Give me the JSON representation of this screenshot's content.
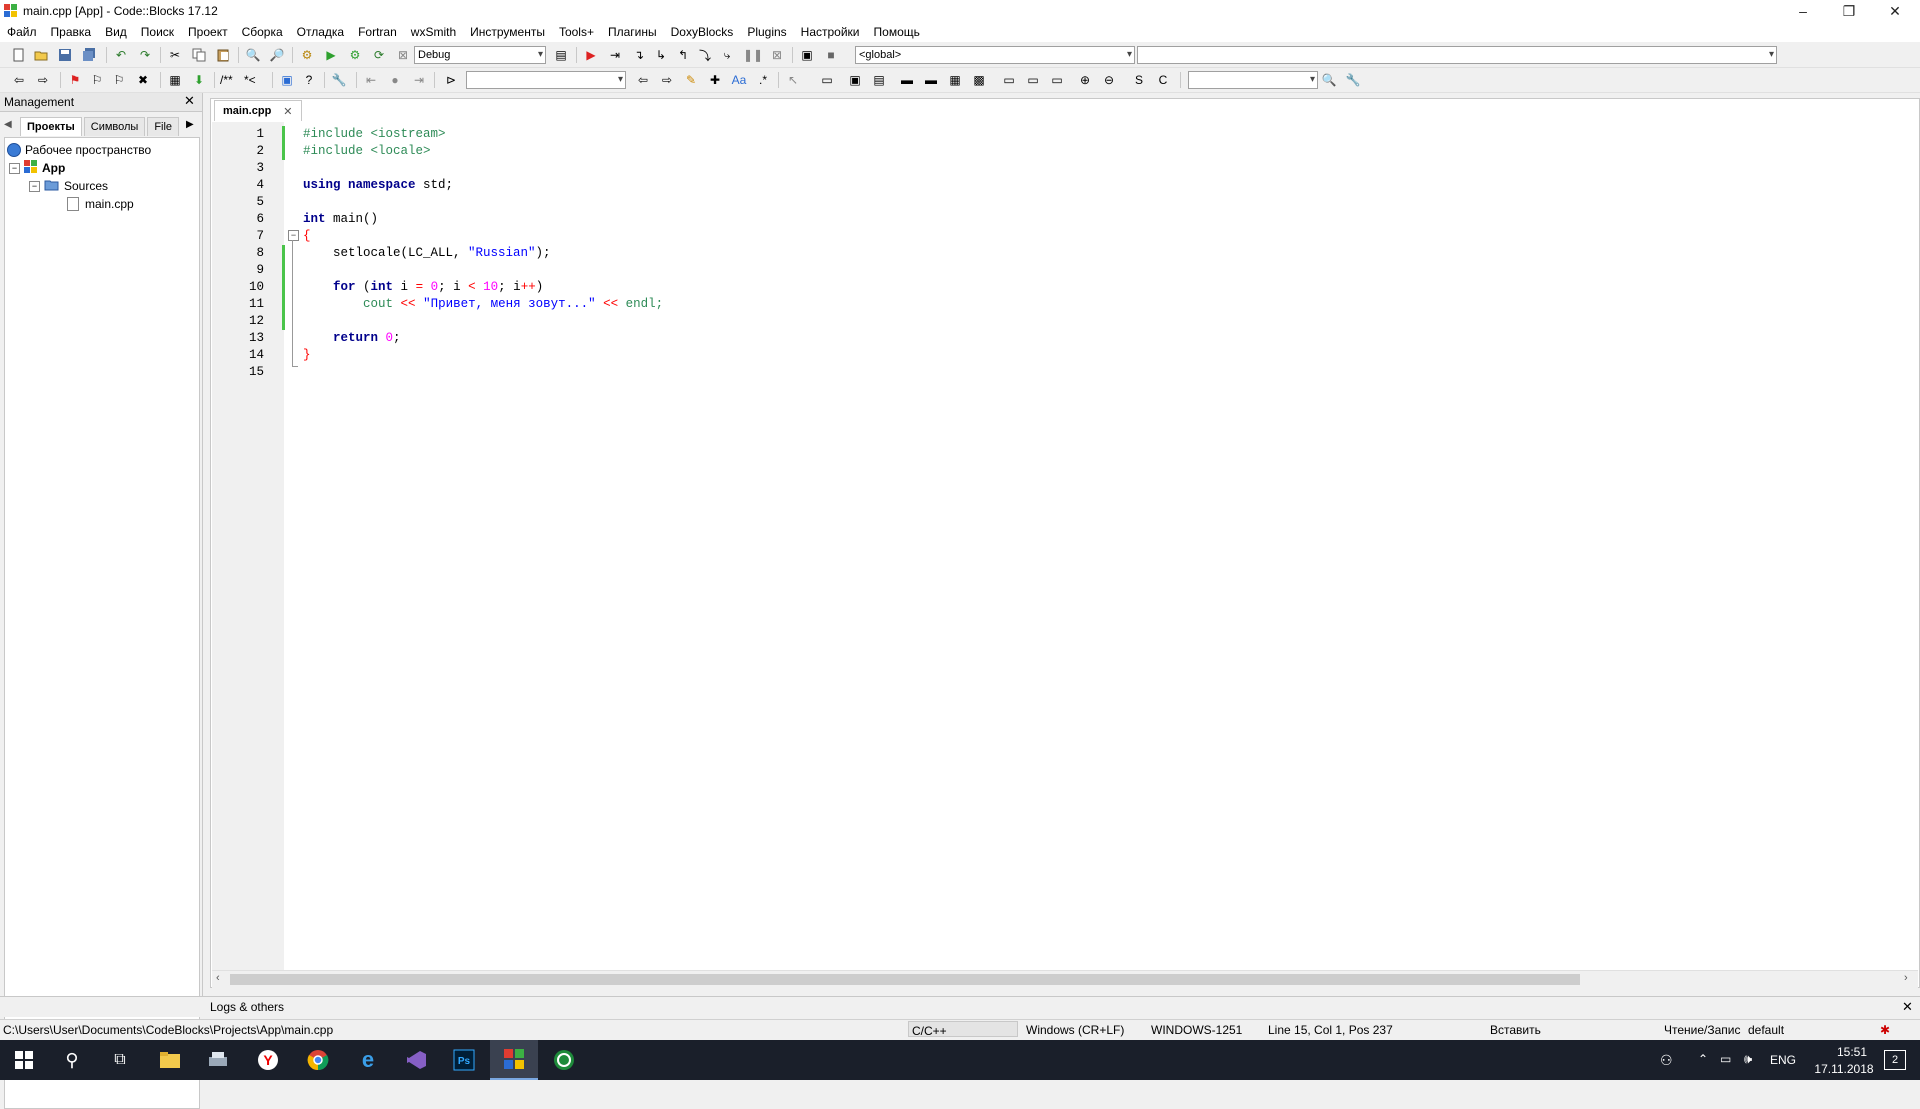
{
  "window": {
    "title": "main.cpp [App] - Code::Blocks 17.12",
    "minimize": "–",
    "restore": "❐",
    "close": "✕"
  },
  "menu": [
    "Файл",
    "Правка",
    "Вид",
    "Поиск",
    "Проект",
    "Сборка",
    "Отладка",
    "Fortran",
    "wxSmith",
    "Инструменты",
    "Tools+",
    "Плагины",
    "DoxyBlocks",
    "Plugins",
    "Настройки",
    "Помощь"
  ],
  "toolbar": {
    "build_target": "Debug",
    "scope": "<global>",
    "doxy_comment_block": "/**",
    "doxy_comment_line": "*<"
  },
  "management": {
    "title": "Management",
    "tabs": [
      "Проекты",
      "Символы",
      "File"
    ],
    "tree": {
      "workspace": "Рабочее пространство",
      "project": "App",
      "folder": "Sources",
      "file": "main.cpp"
    }
  },
  "editor": {
    "tab_label": "main.cpp",
    "line_numbers": [
      "1",
      "2",
      "3",
      "4",
      "5",
      "6",
      "7",
      "8",
      "9",
      "10",
      "11",
      "12",
      "13",
      "14",
      "15"
    ],
    "code": {
      "l1": "#include <iostream>",
      "l2": "#include <locale>",
      "l4_kw1": "using",
      "l4_kw2": "namespace",
      "l4_rest": " std;",
      "l6_kw": "int",
      "l6_rest": " main()",
      "l7": "{",
      "l8_fn": "    setlocale(LC_ALL, ",
      "l8_str": "\"Russian\"",
      "l8_end": ");",
      "l10_kw": "    for",
      "l10_a": " (",
      "l10_kw2": "int",
      "l10_b": " i ",
      "l10_op1": "=",
      "l10_c": " ",
      "l10_n0": "0",
      "l10_d": "; i ",
      "l10_op2": "<",
      "l10_e": " ",
      "l10_n10": "10",
      "l10_f": "; i",
      "l10_op3": "++",
      "l10_g": ")",
      "l11_a": "        cout ",
      "l11_op1": "<<",
      "l11_b": " ",
      "l11_str": "\"Привет, меня зовут...\"",
      "l11_c": " ",
      "l11_op2": "<<",
      "l11_d": " endl;",
      "l13_kw": "    return",
      "l13_a": " ",
      "l13_n": "0",
      "l13_b": ";",
      "l14": "}"
    }
  },
  "logs": {
    "title": "Logs & others"
  },
  "status": {
    "path": "C:\\Users\\User\\Documents\\CodeBlocks\\Projects\\App\\main.cpp",
    "language": "C/C++",
    "eol": "Windows (CR+LF)",
    "encoding": "WINDOWS-1251",
    "position": "Line 15, Col 1, Pos 237",
    "mode": "Вставить",
    "access": "Чтение/Запис",
    "profile": "default"
  },
  "taskbar": {
    "lang": "ENG",
    "time": "15:51",
    "date": "17.11.2018",
    "notifications": "2"
  },
  "colors": {
    "keyword": "#00008b",
    "preprocessor": "#2e8b57",
    "string": "#0000ff",
    "number": "#ff00ff",
    "operator": "#ff0000",
    "change_bar": "#4ac44a"
  }
}
